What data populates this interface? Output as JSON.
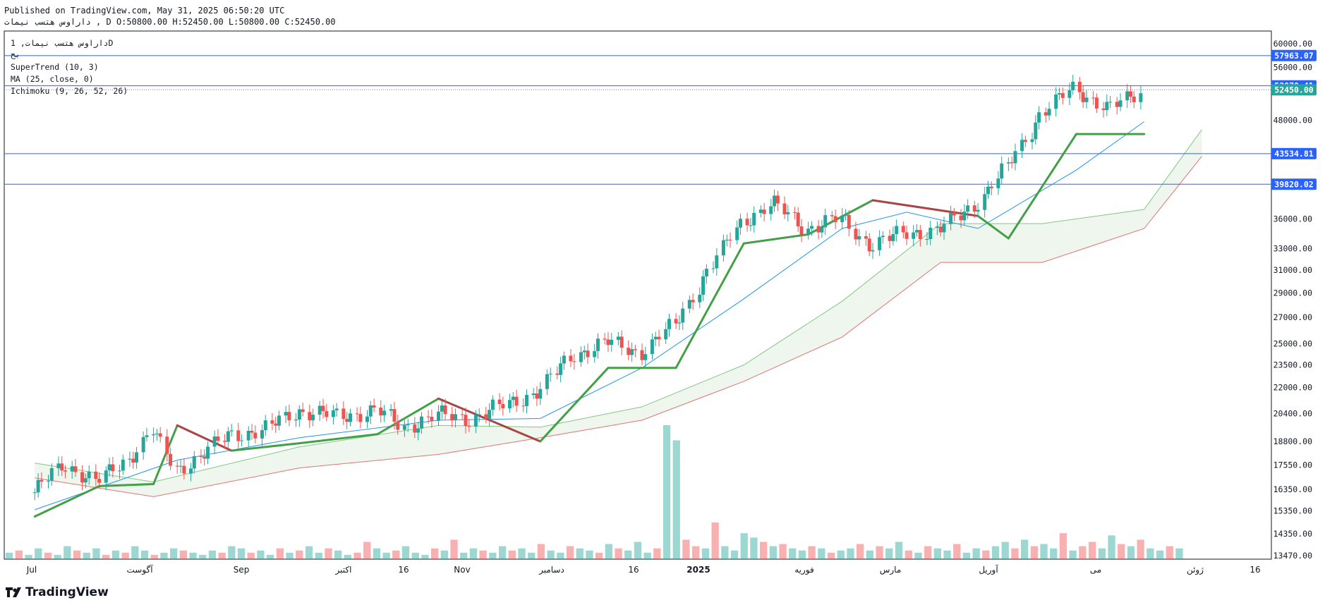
{
  "header": {
    "published": "Published on TradingView.com, May 31, 2025 06:50:20 UTC",
    "symbol_line": "داراوس هتسب نیمات , D O:50800.00 H:52450.00 L:50800.00 C:52450.00"
  },
  "legend": {
    "title": "داراوس هتسب نیمات, 1D",
    "sub": "بح",
    "supertrend": "SuperTrend (10, 3)",
    "ma": "MA (25, close, 0)",
    "ichimoku": "Ichimoku (9, 26, 52, 26)"
  },
  "brand": "TradingView",
  "chart_data": {
    "type": "candlestick",
    "y_scale": "log",
    "ylim": [
      13470,
      61000
    ],
    "y_ticks": [
      "60000.00",
      "56000.00",
      "48000.00",
      "36000.00",
      "33000.00",
      "31000.00",
      "29000.00",
      "27000.00",
      "25000.00",
      "23500.00",
      "22000.00",
      "20400.00",
      "18800.00",
      "17550.00",
      "16350.00",
      "15350.00",
      "14350.00",
      "13470.00"
    ],
    "price_labels": [
      {
        "text": "57963.07",
        "value": 57963.07,
        "color": "#2962ff"
      },
      {
        "text": "53070.41",
        "value": 53070.41,
        "color": "#2962ff"
      },
      {
        "text": "52450.00",
        "value": 52450.0,
        "color": "#26a69a"
      },
      {
        "text": "43534.81",
        "value": 43534.81,
        "color": "#2962ff"
      },
      {
        "text": "39820.02",
        "value": 39820.02,
        "color": "#2962ff"
      }
    ],
    "x_labels": [
      "Jul",
      "آگوست",
      "Sep",
      "اکتبر",
      "16",
      "Nov",
      "دسامبر",
      "16",
      "2025",
      "فوریه",
      "مارس",
      "آوریل",
      "می",
      "ژوئن",
      "16"
    ],
    "ohlc_points": [
      {
        "date": "2024-07-01",
        "close": 16200
      },
      {
        "date": "2024-07-10",
        "close": 17600
      },
      {
        "date": "2024-07-20",
        "close": 16700
      },
      {
        "date": "2024-07-29",
        "close": 17900
      },
      {
        "date": "2024-08-05",
        "close": 19400
      },
      {
        "date": "2024-08-12",
        "close": 17300
      },
      {
        "date": "2024-08-20",
        "close": 18100
      },
      {
        "date": "2024-08-28",
        "close": 19200
      },
      {
        "date": "2024-09-07",
        "close": 19400
      },
      {
        "date": "2024-09-17",
        "close": 20600
      },
      {
        "date": "2024-09-29",
        "close": 20200
      },
      {
        "date": "2024-10-10",
        "close": 20600
      },
      {
        "date": "2024-10-18",
        "close": 19600
      },
      {
        "date": "2024-10-28",
        "close": 20300
      },
      {
        "date": "2024-11-07",
        "close": 20100
      },
      {
        "date": "2024-11-17",
        "close": 20900
      },
      {
        "date": "2024-11-27",
        "close": 21800
      },
      {
        "date": "2024-12-07",
        "close": 24200
      },
      {
        "date": "2024-12-17",
        "close": 25100
      },
      {
        "date": "2024-12-27",
        "close": 24400
      },
      {
        "date": "2025-01-06",
        "close": 26400
      },
      {
        "date": "2025-01-16",
        "close": 31000
      },
      {
        "date": "2025-01-26",
        "close": 35800
      },
      {
        "date": "2025-02-04",
        "close": 37600
      },
      {
        "date": "2025-02-14",
        "close": 35000
      },
      {
        "date": "2025-02-24",
        "close": 36000
      },
      {
        "date": "2025-03-05",
        "close": 33300
      },
      {
        "date": "2025-03-15",
        "close": 34600
      },
      {
        "date": "2025-03-25",
        "close": 34800
      },
      {
        "date": "2025-04-05",
        "close": 37700
      },
      {
        "date": "2025-04-14",
        "close": 41800
      },
      {
        "date": "2025-04-24",
        "close": 49000
      },
      {
        "date": "2025-05-04",
        "close": 52800
      },
      {
        "date": "2025-05-14",
        "close": 49500
      },
      {
        "date": "2025-05-24",
        "close": 52450
      }
    ],
    "supertrend": [
      {
        "date": "2024-07-01",
        "value": 15100
      },
      {
        "date": "2024-07-20",
        "value": 16500
      },
      {
        "date": "2024-08-05",
        "value": 16600
      },
      {
        "date": "2024-08-12",
        "value": 19700
      },
      {
        "date": "2024-08-28",
        "value": 18300
      },
      {
        "date": "2024-09-17",
        "value": 18700
      },
      {
        "date": "2024-10-10",
        "value": 19200
      },
      {
        "date": "2024-10-28",
        "value": 21300
      },
      {
        "date": "2024-11-27",
        "value": 18800
      },
      {
        "date": "2024-12-17",
        "value": 23300
      },
      {
        "date": "2025-01-06",
        "value": 23300
      },
      {
        "date": "2025-01-26",
        "value": 33500
      },
      {
        "date": "2025-02-14",
        "value": 34400
      },
      {
        "date": "2025-03-05",
        "value": 38000
      },
      {
        "date": "2025-04-05",
        "value": 36300
      },
      {
        "date": "2025-04-14",
        "value": 34000
      },
      {
        "date": "2025-05-04",
        "value": 46100
      },
      {
        "date": "2025-05-24",
        "value": 46100
      }
    ],
    "moving_average": [
      {
        "date": "2024-07-01",
        "value": 15400
      },
      {
        "date": "2024-08-12",
        "value": 17800
      },
      {
        "date": "2024-09-17",
        "value": 19000
      },
      {
        "date": "2024-10-28",
        "value": 20000
      },
      {
        "date": "2024-11-27",
        "value": 20100
      },
      {
        "date": "2024-12-27",
        "value": 23300
      },
      {
        "date": "2025-01-26",
        "value": 28500
      },
      {
        "date": "2025-02-24",
        "value": 35000
      },
      {
        "date": "2025-03-15",
        "value": 36700
      },
      {
        "date": "2025-04-05",
        "value": 35000
      },
      {
        "date": "2025-05-04",
        "value": 41500
      },
      {
        "date": "2025-05-24",
        "value": 47800
      }
    ],
    "cloud_top": [
      {
        "date": "2024-07-01",
        "value": 17650
      },
      {
        "date": "2024-08-05",
        "value": 16700
      },
      {
        "date": "2024-09-17",
        "value": 18500
      },
      {
        "date": "2024-10-28",
        "value": 19700
      },
      {
        "date": "2024-11-27",
        "value": 19600
      },
      {
        "date": "2024-12-27",
        "value": 20800
      },
      {
        "date": "2025-01-26",
        "value": 23500
      },
      {
        "date": "2025-02-24",
        "value": 28300
      },
      {
        "date": "2025-03-25",
        "value": 35500
      },
      {
        "date": "2025-04-24",
        "value": 35500
      },
      {
        "date": "2025-05-24",
        "value": 37000
      },
      {
        "date": "2025-06-10",
        "value": 46700
      }
    ],
    "cloud_bottom": [
      {
        "date": "2024-07-01",
        "value": 16900
      },
      {
        "date": "2024-08-05",
        "value": 16000
      },
      {
        "date": "2024-09-17",
        "value": 17400
      },
      {
        "date": "2024-10-28",
        "value": 18100
      },
      {
        "date": "2024-11-27",
        "value": 19000
      },
      {
        "date": "2024-12-27",
        "value": 20000
      },
      {
        "date": "2025-01-26",
        "value": 22400
      },
      {
        "date": "2025-02-24",
        "value": 25500
      },
      {
        "date": "2025-03-25",
        "value": 31700
      },
      {
        "date": "2025-04-24",
        "value": 31700
      },
      {
        "date": "2025-05-24",
        "value": 35000
      },
      {
        "date": "2025-06-10",
        "value": 43200
      }
    ],
    "volume": {
      "values": [
        3,
        4,
        2,
        5,
        3,
        2,
        6,
        4,
        3,
        5,
        2,
        4,
        3,
        6,
        4,
        2,
        3,
        5,
        4,
        3,
        2,
        4,
        3,
        6,
        5,
        3,
        4,
        2,
        5,
        3,
        4,
        6,
        3,
        5,
        4,
        2,
        3,
        8,
        5,
        3,
        4,
        6,
        3,
        2,
        5,
        4,
        9,
        3,
        5,
        4,
        3,
        6,
        4,
        5,
        3,
        7,
        4,
        3,
        6,
        5,
        4,
        3,
        7,
        5,
        4,
        8,
        3,
        5,
        62,
        55,
        9,
        6,
        5,
        17,
        6,
        4,
        12,
        10,
        8,
        6,
        7,
        5,
        4,
        6,
        5,
        3,
        4,
        5,
        7,
        4,
        6,
        5,
        8,
        4,
        3,
        6,
        5,
        4,
        7,
        3,
        5,
        4,
        6,
        8,
        5,
        9,
        6,
        7,
        5,
        12,
        4,
        6,
        8,
        5,
        11,
        7,
        6,
        9,
        5,
        4,
        6,
        5
      ],
      "up": [
        1,
        0,
        1,
        1,
        0,
        1,
        1,
        0,
        1,
        1,
        0,
        1,
        0,
        1,
        1,
        0,
        1,
        1,
        0,
        1,
        1,
        1,
        0,
        1,
        1,
        0,
        1,
        1,
        0,
        1,
        0,
        1,
        1,
        0,
        1,
        1,
        0,
        0,
        1,
        1,
        0,
        1,
        1,
        1,
        0,
        1,
        0,
        1,
        1,
        0,
        1,
        1,
        0,
        1,
        1,
        0,
        1,
        1,
        0,
        1,
        1,
        0,
        1,
        0,
        1,
        1,
        1,
        0,
        1,
        1,
        0,
        0,
        1,
        0,
        1,
        1,
        1,
        1,
        0,
        1,
        0,
        1,
        1,
        0,
        1,
        0,
        1,
        1,
        0,
        1,
        0,
        1,
        1,
        0,
        1,
        0,
        1,
        1,
        0,
        1,
        1,
        0,
        1,
        1,
        0,
        1,
        0,
        1,
        1,
        0,
        1,
        0,
        0,
        1,
        1,
        0,
        1,
        0,
        1,
        1,
        0,
        1
      ]
    }
  }
}
